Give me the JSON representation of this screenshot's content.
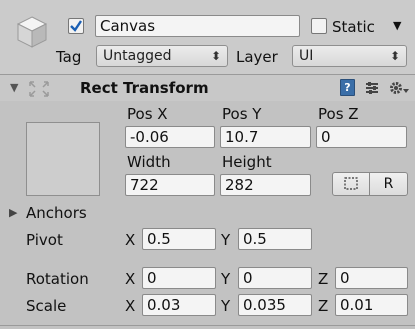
{
  "header": {
    "name_value": "Canvas",
    "active_checked": true,
    "static_label": "Static",
    "static_checked": false,
    "tag_label": "Tag",
    "tag_value": "Untagged",
    "layer_label": "Layer",
    "layer_value": "UI"
  },
  "rect_transform": {
    "title": "Rect Transform",
    "pos_x_label": "Pos X",
    "pos_y_label": "Pos Y",
    "pos_z_label": "Pos Z",
    "pos_x": "-0.06",
    "pos_y": "10.7",
    "pos_z": "0",
    "width_label": "Width",
    "height_label": "Height",
    "width": "722",
    "height": "282",
    "raw_button_label": "R",
    "anchors_label": "Anchors",
    "pivot_label": "Pivot",
    "pivot_x": "0.5",
    "pivot_y": "0.5",
    "rotation_label": "Rotation",
    "rotation_x": "0",
    "rotation_y": "0",
    "rotation_z": "0",
    "scale_label": "Scale",
    "scale_x": "0.03",
    "scale_y": "0.035",
    "scale_z": "0.01",
    "axis_x": "X",
    "axis_y": "Y",
    "axis_z": "Z"
  },
  "colors": {
    "background": "#c2c2c2",
    "checkbox_check": "#1a5fb4",
    "help_icon": "#3a6ea8"
  }
}
